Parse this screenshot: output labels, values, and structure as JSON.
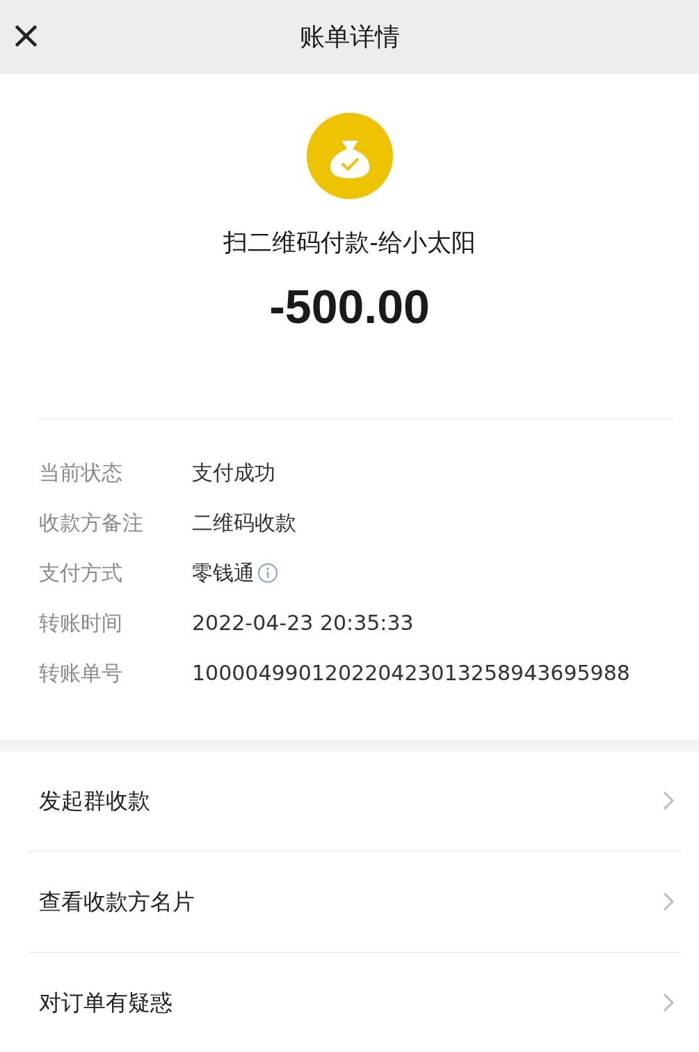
{
  "header": {
    "close": "×",
    "title": "账单详情"
  },
  "payment": {
    "title": "扫二维码付款-给小太阳",
    "amount": "-500.00"
  },
  "details": [
    {
      "label": "当前状态",
      "value": "支付成功"
    },
    {
      "label": "收款方备注",
      "value": "二维码收款"
    },
    {
      "label": "支付方式",
      "value": "零钱通",
      "info": true
    },
    {
      "label": "转账时间",
      "value": "2022-04-23 20:35:33"
    },
    {
      "label": "转账单号",
      "value": "100004990120220423013258943695988"
    }
  ],
  "actions": [
    {
      "label": "发起群收款"
    },
    {
      "label": "查看收款方名片"
    },
    {
      "label": "对订单有疑惑"
    }
  ]
}
